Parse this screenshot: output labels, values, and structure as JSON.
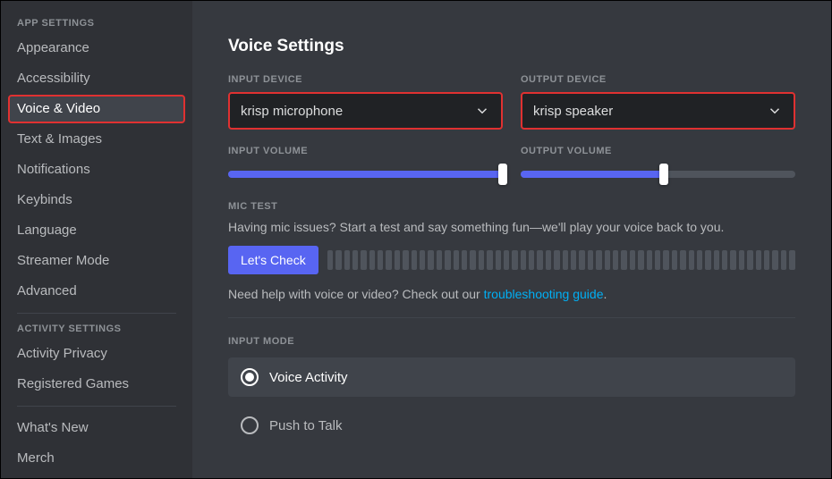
{
  "sidebar": {
    "sections": [
      {
        "header": "App Settings",
        "items": [
          {
            "label": "Appearance",
            "active": false
          },
          {
            "label": "Accessibility",
            "active": false
          },
          {
            "label": "Voice & Video",
            "active": true
          },
          {
            "label": "Text & Images",
            "active": false
          },
          {
            "label": "Notifications",
            "active": false
          },
          {
            "label": "Keybinds",
            "active": false
          },
          {
            "label": "Language",
            "active": false
          },
          {
            "label": "Streamer Mode",
            "active": false
          },
          {
            "label": "Advanced",
            "active": false
          }
        ]
      },
      {
        "header": "Activity Settings",
        "items": [
          {
            "label": "Activity Privacy",
            "active": false
          },
          {
            "label": "Registered Games",
            "active": false
          }
        ]
      },
      {
        "header": null,
        "items": [
          {
            "label": "What's New",
            "active": false
          },
          {
            "label": "Merch",
            "active": false
          }
        ]
      }
    ]
  },
  "main": {
    "title": "Voice Settings",
    "input_device": {
      "label": "Input Device",
      "value": "krisp microphone"
    },
    "output_device": {
      "label": "Output Device",
      "value": "krisp speaker"
    },
    "input_volume": {
      "label": "Input Volume",
      "value_pct": 100
    },
    "output_volume": {
      "label": "Output Volume",
      "value_pct": 52
    },
    "mic_test": {
      "label": "Mic Test",
      "description": "Having mic issues? Start a test and say something fun—we'll play your voice back to you.",
      "button": "Let's Check"
    },
    "help_text": {
      "prefix": "Need help with voice or video? Check out our ",
      "link": "troubleshooting guide",
      "suffix": "."
    },
    "input_mode": {
      "label": "Input Mode",
      "options": [
        {
          "label": "Voice Activity",
          "selected": true
        },
        {
          "label": "Push to Talk",
          "selected": false
        }
      ]
    }
  },
  "colors": {
    "accent": "#5865f2",
    "highlight_border": "#e03131",
    "link": "#00aff4"
  }
}
